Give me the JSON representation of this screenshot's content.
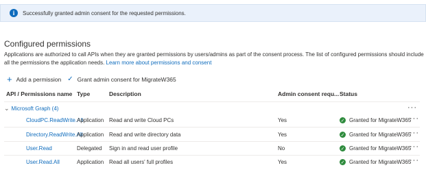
{
  "banner": {
    "icon": "info-icon",
    "text": "Successfully granted admin consent for the requested permissions."
  },
  "section": {
    "title": "Configured permissions",
    "description": "Applications are authorized to call APIs when they are granted permissions by users/admins as part of the consent process. The list of configured permissions should include all the permissions the application needs.",
    "link": "Learn more about permissions and consent"
  },
  "toolbar": {
    "add_label": "Add a permission",
    "grant_label": "Grant admin consent for MigrateW365"
  },
  "table": {
    "headers": {
      "name": "API / Permissions name",
      "type": "Type",
      "description": "Description",
      "admin": "Admin consent requ...",
      "status": "Status"
    },
    "group": {
      "label": "Microsoft Graph (4)",
      "more": "···"
    },
    "rows": [
      {
        "name": "CloudPC.ReadWrite.All",
        "type": "Application",
        "description": "Read and write Cloud PCs",
        "admin": "Yes",
        "status": "Granted for MigrateW365",
        "more": "···"
      },
      {
        "name": "Directory.ReadWrite.All",
        "type": "Application",
        "description": "Read and write directory data",
        "admin": "Yes",
        "status": "Granted for MigrateW365",
        "more": "···"
      },
      {
        "name": "User.Read",
        "type": "Delegated",
        "description": "Sign in and read user profile",
        "admin": "No",
        "status": "Granted for MigrateW365",
        "more": "···"
      },
      {
        "name": "User.Read.All",
        "type": "Application",
        "description": "Read all users' full profiles",
        "admin": "Yes",
        "status": "Granted for MigrateW365",
        "more": "···"
      }
    ]
  },
  "colors": {
    "accent": "#0f6cbd",
    "success": "#2e8b3d",
    "banner_bg": "#eaf1fb"
  }
}
